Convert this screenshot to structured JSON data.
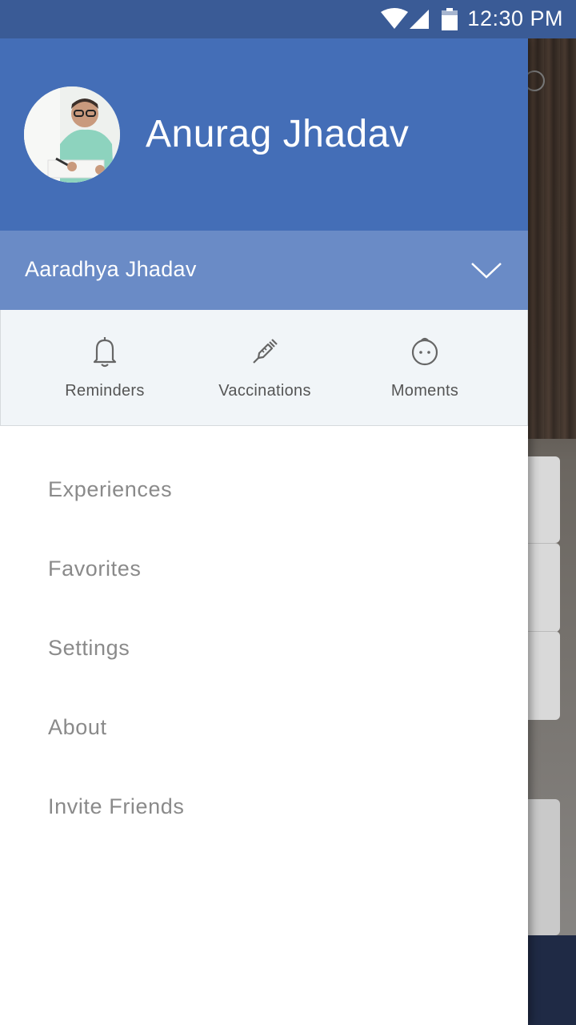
{
  "status_bar": {
    "time": "12:30 PM",
    "icons": [
      "wifi-icon",
      "signal-icon",
      "battery-icon"
    ]
  },
  "drawer": {
    "user_name": "Anurag Jhadav",
    "child_selector": {
      "name": "Aaradhya Jhadav",
      "icon": "chevron-down-icon"
    },
    "quick_actions": [
      {
        "label": "Reminders",
        "icon": "bell-icon"
      },
      {
        "label": "Vaccinations",
        "icon": "syringe-icon"
      },
      {
        "label": "Moments",
        "icon": "baby-face-icon"
      }
    ],
    "menu": [
      {
        "label": "Experiences"
      },
      {
        "label": "Favorites"
      },
      {
        "label": "Settings"
      },
      {
        "label": "About"
      },
      {
        "label": "Invite Friends"
      }
    ]
  },
  "colors": {
    "header": "#446eb7",
    "child_row": "#6a8bc6",
    "status_bar": "#3a5b96",
    "quick_row_bg": "#f1f5f8",
    "menu_text": "#8a8a8a"
  }
}
